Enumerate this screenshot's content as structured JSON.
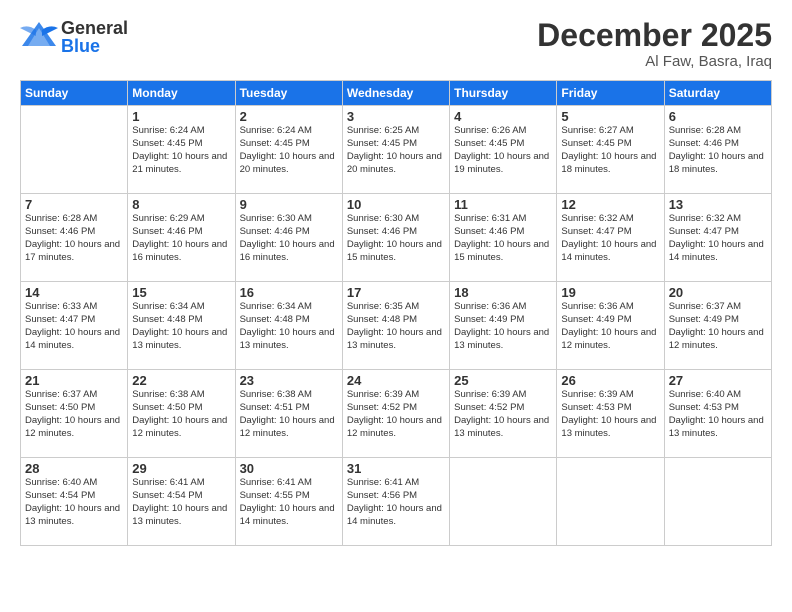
{
  "header": {
    "logo_general": "General",
    "logo_blue": "Blue",
    "title": "December 2025",
    "subtitle": "Al Faw, Basra, Iraq"
  },
  "days_of_week": [
    "Sunday",
    "Monday",
    "Tuesday",
    "Wednesday",
    "Thursday",
    "Friday",
    "Saturday"
  ],
  "weeks": [
    [
      {
        "day": "",
        "info": ""
      },
      {
        "day": "1",
        "info": "Sunrise: 6:24 AM\nSunset: 4:45 PM\nDaylight: 10 hours\nand 21 minutes."
      },
      {
        "day": "2",
        "info": "Sunrise: 6:24 AM\nSunset: 4:45 PM\nDaylight: 10 hours\nand 20 minutes."
      },
      {
        "day": "3",
        "info": "Sunrise: 6:25 AM\nSunset: 4:45 PM\nDaylight: 10 hours\nand 20 minutes."
      },
      {
        "day": "4",
        "info": "Sunrise: 6:26 AM\nSunset: 4:45 PM\nDaylight: 10 hours\nand 19 minutes."
      },
      {
        "day": "5",
        "info": "Sunrise: 6:27 AM\nSunset: 4:45 PM\nDaylight: 10 hours\nand 18 minutes."
      },
      {
        "day": "6",
        "info": "Sunrise: 6:28 AM\nSunset: 4:46 PM\nDaylight: 10 hours\nand 18 minutes."
      }
    ],
    [
      {
        "day": "7",
        "info": "Sunrise: 6:28 AM\nSunset: 4:46 PM\nDaylight: 10 hours\nand 17 minutes."
      },
      {
        "day": "8",
        "info": "Sunrise: 6:29 AM\nSunset: 4:46 PM\nDaylight: 10 hours\nand 16 minutes."
      },
      {
        "day": "9",
        "info": "Sunrise: 6:30 AM\nSunset: 4:46 PM\nDaylight: 10 hours\nand 16 minutes."
      },
      {
        "day": "10",
        "info": "Sunrise: 6:30 AM\nSunset: 4:46 PM\nDaylight: 10 hours\nand 15 minutes."
      },
      {
        "day": "11",
        "info": "Sunrise: 6:31 AM\nSunset: 4:46 PM\nDaylight: 10 hours\nand 15 minutes."
      },
      {
        "day": "12",
        "info": "Sunrise: 6:32 AM\nSunset: 4:47 PM\nDaylight: 10 hours\nand 14 minutes."
      },
      {
        "day": "13",
        "info": "Sunrise: 6:32 AM\nSunset: 4:47 PM\nDaylight: 10 hours\nand 14 minutes."
      }
    ],
    [
      {
        "day": "14",
        "info": "Sunrise: 6:33 AM\nSunset: 4:47 PM\nDaylight: 10 hours\nand 14 minutes."
      },
      {
        "day": "15",
        "info": "Sunrise: 6:34 AM\nSunset: 4:48 PM\nDaylight: 10 hours\nand 13 minutes."
      },
      {
        "day": "16",
        "info": "Sunrise: 6:34 AM\nSunset: 4:48 PM\nDaylight: 10 hours\nand 13 minutes."
      },
      {
        "day": "17",
        "info": "Sunrise: 6:35 AM\nSunset: 4:48 PM\nDaylight: 10 hours\nand 13 minutes."
      },
      {
        "day": "18",
        "info": "Sunrise: 6:36 AM\nSunset: 4:49 PM\nDaylight: 10 hours\nand 13 minutes."
      },
      {
        "day": "19",
        "info": "Sunrise: 6:36 AM\nSunset: 4:49 PM\nDaylight: 10 hours\nand 12 minutes."
      },
      {
        "day": "20",
        "info": "Sunrise: 6:37 AM\nSunset: 4:49 PM\nDaylight: 10 hours\nand 12 minutes."
      }
    ],
    [
      {
        "day": "21",
        "info": "Sunrise: 6:37 AM\nSunset: 4:50 PM\nDaylight: 10 hours\nand 12 minutes."
      },
      {
        "day": "22",
        "info": "Sunrise: 6:38 AM\nSunset: 4:50 PM\nDaylight: 10 hours\nand 12 minutes."
      },
      {
        "day": "23",
        "info": "Sunrise: 6:38 AM\nSunset: 4:51 PM\nDaylight: 10 hours\nand 12 minutes."
      },
      {
        "day": "24",
        "info": "Sunrise: 6:39 AM\nSunset: 4:52 PM\nDaylight: 10 hours\nand 12 minutes."
      },
      {
        "day": "25",
        "info": "Sunrise: 6:39 AM\nSunset: 4:52 PM\nDaylight: 10 hours\nand 13 minutes."
      },
      {
        "day": "26",
        "info": "Sunrise: 6:39 AM\nSunset: 4:53 PM\nDaylight: 10 hours\nand 13 minutes."
      },
      {
        "day": "27",
        "info": "Sunrise: 6:40 AM\nSunset: 4:53 PM\nDaylight: 10 hours\nand 13 minutes."
      }
    ],
    [
      {
        "day": "28",
        "info": "Sunrise: 6:40 AM\nSunset: 4:54 PM\nDaylight: 10 hours\nand 13 minutes."
      },
      {
        "day": "29",
        "info": "Sunrise: 6:41 AM\nSunset: 4:54 PM\nDaylight: 10 hours\nand 13 minutes."
      },
      {
        "day": "30",
        "info": "Sunrise: 6:41 AM\nSunset: 4:55 PM\nDaylight: 10 hours\nand 14 minutes."
      },
      {
        "day": "31",
        "info": "Sunrise: 6:41 AM\nSunset: 4:56 PM\nDaylight: 10 hours\nand 14 minutes."
      },
      {
        "day": "",
        "info": ""
      },
      {
        "day": "",
        "info": ""
      },
      {
        "day": "",
        "info": ""
      }
    ]
  ]
}
